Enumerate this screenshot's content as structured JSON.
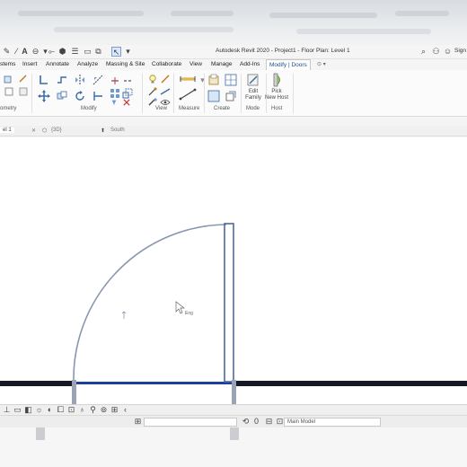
{
  "window": {
    "title": "Autodesk Revit 2020 - Project1 - Floor Plan: Level 1",
    "sign_in": "Sign"
  },
  "ribbon_tabs": [
    {
      "label": "stems"
    },
    {
      "label": "Insert"
    },
    {
      "label": "Annotate"
    },
    {
      "label": "Analyze"
    },
    {
      "label": "Massing & Site"
    },
    {
      "label": "Collaborate"
    },
    {
      "label": "View"
    },
    {
      "label": "Manage"
    },
    {
      "label": "Add-Ins"
    },
    {
      "label": "Modify | Doors"
    }
  ],
  "ribbon_groups": {
    "geometry": "ometry",
    "modify": "Modify",
    "view": "View",
    "measure": "Measure",
    "create": "Create",
    "mode": "Mode",
    "host": "Host"
  },
  "ribbon_buttons": {
    "edit_family_line1": "Edit",
    "edit_family_line2": "Family",
    "pick_new_host_line1": "Pick",
    "pick_new_host_line2": "New Host"
  },
  "view_tabs": [
    {
      "label": "el 1"
    },
    {
      "label": "{3D}"
    },
    {
      "label": "South"
    }
  ],
  "canvas": {
    "cursor_tag": "Eng"
  },
  "status_bar": {
    "workset_value": "",
    "zero_value": "0",
    "model_value": "Main Model"
  },
  "colors": {
    "accent": "#1a4f8c",
    "wall": "#151a24",
    "door_line": "#8896b0",
    "selection": "#1d3f9e"
  }
}
